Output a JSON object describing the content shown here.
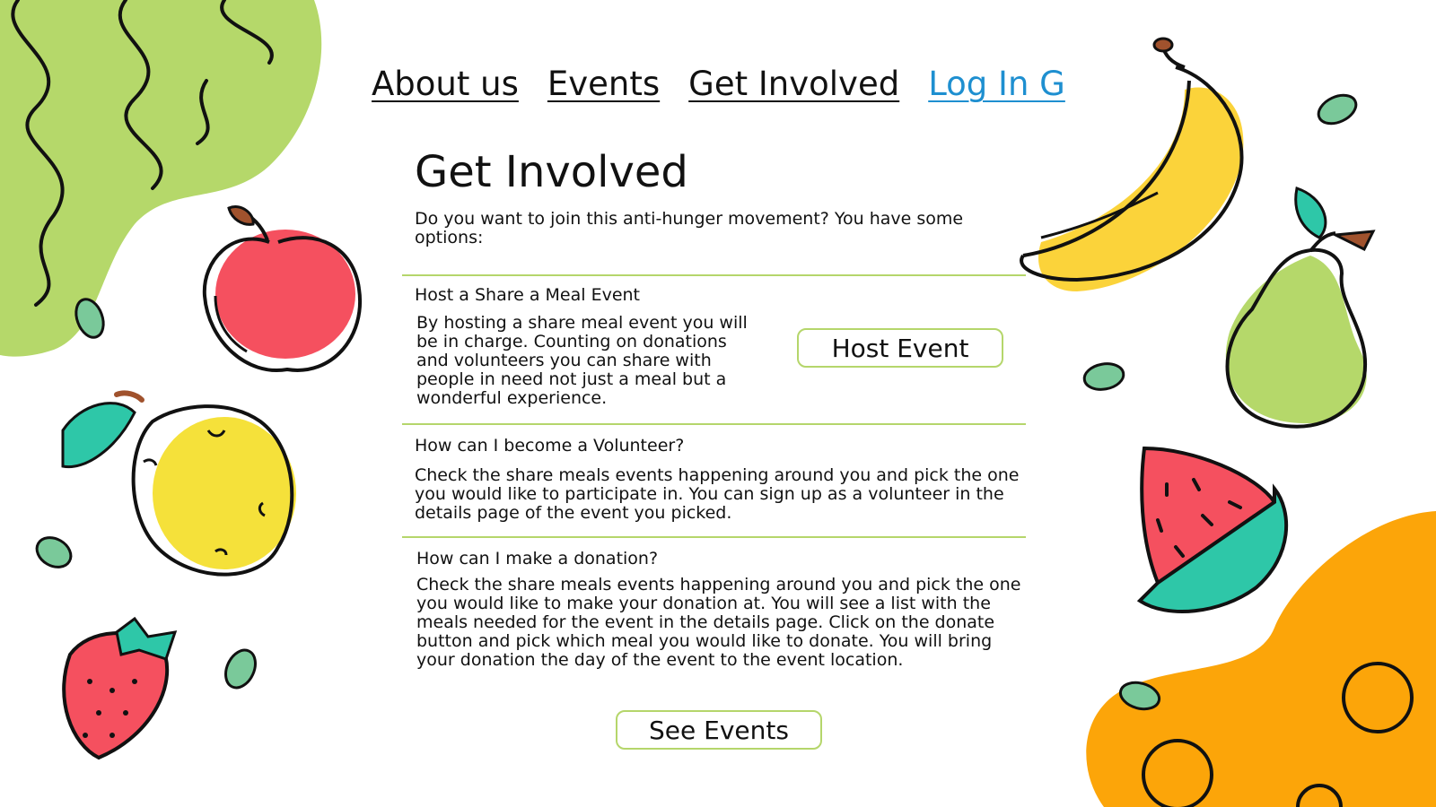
{
  "nav": {
    "items": [
      {
        "label": "About us"
      },
      {
        "label": "Events"
      },
      {
        "label": "Get Involved"
      },
      {
        "label": "Log In G"
      }
    ]
  },
  "page": {
    "title": "Get Involved",
    "intro": "Do you want to join this anti-hunger movement? You have some options:"
  },
  "sections": [
    {
      "heading": "Host a Share a  Meal Event",
      "body": "By hosting a share meal event you will be in charge. Counting on donations and volunteers you can share with people in need not just a meal but a wonderful experience.",
      "button_label": "Host Event"
    },
    {
      "heading": "How can I become a Volunteer?",
      "body": "Check the share meals events happening around you and pick the one you would like to participate in. You can sign up as a volunteer in the details page of the event you picked."
    },
    {
      "heading": "How can I make a donation?",
      "body": "Check the share meals events happening around you and pick the one you would like to make your donation at. You will see a list with the  meals needed for the event in the details page. Click on the donate button and pick which meal you would like to donate. You will bring your donation the day of the event to the event location."
    }
  ],
  "footer": {
    "see_events_label": "See Events"
  },
  "colors": {
    "accent_green": "#b5d66b",
    "link_blue": "#1e8fd0",
    "blob_green": "#b5d86a",
    "blob_orange": "#fca509",
    "apple_red": "#f5505f",
    "banana_yellow": "#fbd33a",
    "lemon_yellow": "#f5e13a",
    "leaf_teal": "#2ec7a8",
    "pear_green": "#b5d86a"
  },
  "decorations": [
    "apple-icon",
    "lemon-icon",
    "strawberry-icon",
    "banana-icon",
    "pear-icon",
    "watermelon-icon",
    "leaf-icon"
  ]
}
